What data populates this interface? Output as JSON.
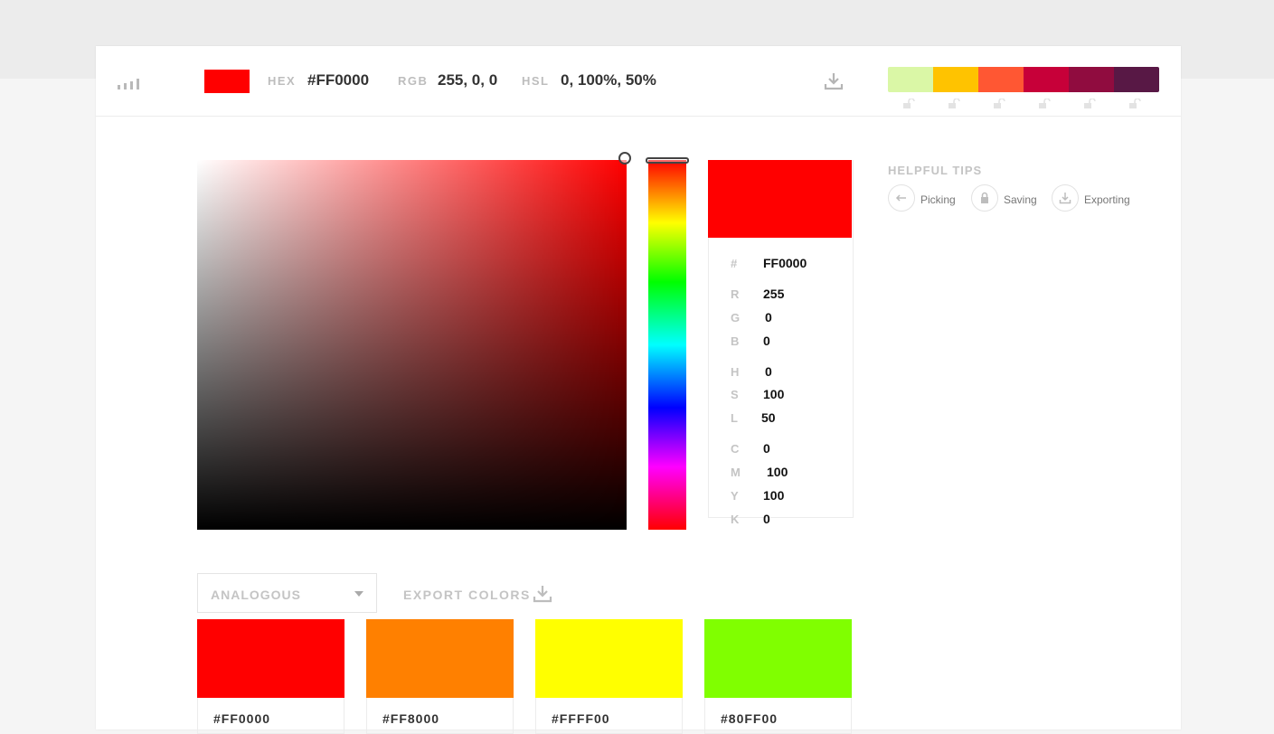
{
  "header": {
    "current_color": "#FF0000",
    "hex_label": "HEX",
    "hex_value": "#FF0000",
    "rgb_label": "RGB",
    "rgb_value": "255, 0, 0",
    "hsl_label": "HSL",
    "hsl_value": "0, 100%, 50%",
    "palette": [
      "#DAF7A6",
      "#FFC300",
      "#FF5733",
      "#C70039",
      "#900C3F",
      "#581845"
    ]
  },
  "picker": {
    "hue_color": "#FF0000"
  },
  "details": {
    "swatch": "#FF0000",
    "rows": [
      {
        "key": "#",
        "value": "FF0000"
      },
      {
        "key": "R",
        "value": "255"
      },
      {
        "key": "G",
        "value": "0"
      },
      {
        "key": "B",
        "value": "0"
      },
      {
        "key": "H",
        "value": "0"
      },
      {
        "key": "S",
        "value": "100"
      },
      {
        "key": "L",
        "value": "50"
      },
      {
        "key": "C",
        "value": "0"
      },
      {
        "key": "M",
        "value": "100"
      },
      {
        "key": "Y",
        "value": "100"
      },
      {
        "key": "K",
        "value": "0"
      }
    ]
  },
  "tips": {
    "title": "HELPFUL TIPS",
    "items": [
      {
        "label": "Picking",
        "icon": "arrow-left-icon"
      },
      {
        "label": "Saving",
        "icon": "lock-icon"
      },
      {
        "label": "Exporting",
        "icon": "download-icon"
      }
    ]
  },
  "scheme": {
    "selected": "ANALOGOUS",
    "export_label": "EXPORT COLORS",
    "colors": [
      {
        "hex": "#FF0000"
      },
      {
        "hex": "#FF8000"
      },
      {
        "hex": "#FFFF00"
      },
      {
        "hex": "#80FF00"
      }
    ]
  }
}
